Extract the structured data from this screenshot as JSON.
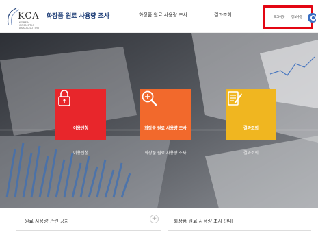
{
  "header": {
    "logo_text": "KCA",
    "logo_sub": "KOREA COSMETIC ASSOCIATION",
    "site_title": "화장품 원료 사용량 조사",
    "nav": {
      "survey": "화장품 원료 사용량 조사",
      "result": "결과조회"
    },
    "account": {
      "logout": "로그아웃",
      "info": "정보수정"
    }
  },
  "tiles": [
    {
      "label": "이용신청",
      "under_label": "이용신청",
      "color": "#e8262b",
      "icon": "lock-icon"
    },
    {
      "label": "화장품 원료 사용량 조사",
      "under_label": "화장품 원료 사용량 조사",
      "color": "#f2692c",
      "icon": "search-plus-icon"
    },
    {
      "label": "결과조회",
      "under_label": "결과조회",
      "color": "#f0b620",
      "icon": "document-edit-icon"
    }
  ],
  "panels": {
    "notice_title": "원료 사용량 관련 공지",
    "guide_title": "화장품 원료 사용량 조사 안내",
    "more_symbol": "+"
  },
  "colors": {
    "brand_navy": "#1f3f78",
    "highlight_red": "#e30613"
  }
}
